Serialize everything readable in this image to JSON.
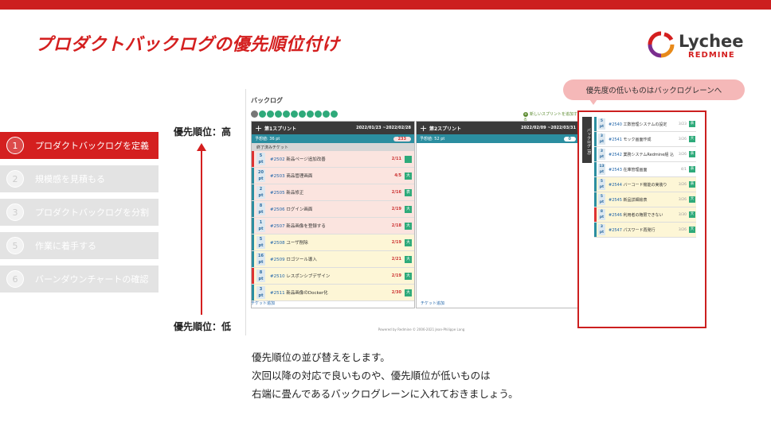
{
  "slide": {
    "title": "プロダクトバックログの優先順位付け",
    "logo_word": "Lychee",
    "logo_sub": "REDMINE"
  },
  "steps": [
    {
      "num": "1",
      "label": "プロダクトバックログを定義",
      "active": true
    },
    {
      "num": "2",
      "label": "規模感を見積もる",
      "active": false
    },
    {
      "num": "3",
      "label": "プロダクトバックログを分割",
      "active": false
    },
    {
      "num": "5",
      "label": "作業に着手する",
      "active": false
    },
    {
      "num": "6",
      "label": "バーンダウンチャートの確認",
      "active": false
    }
  ],
  "priority": {
    "high": "優先順位：高",
    "low": "優先順位：低"
  },
  "screen": {
    "title": "バックログ",
    "new_sprint": "新しいスプリントを追加する",
    "footer": "Powered by Redmine © 2006-2021 Jean-Philippe Lang",
    "sprint1": {
      "name": "第1スプリント",
      "dates": "2022/01/23 ~2022/02/28",
      "estimate": "予想値: 36 pt",
      "pill": "233",
      "done": "終了済みチケット",
      "add": "チケット追加",
      "tickets": [
        {
          "pts": "5 pt",
          "id": "#2502",
          "title": "新品ページ追加改善",
          "due": "2/11",
          "tag": "",
          "color": "pink",
          "edge": "#d33"
        },
        {
          "pts": "20 pt",
          "id": "#2503",
          "title": "商品管理画面",
          "due": "4/5",
          "tag": "大",
          "color": "pink",
          "edge": "#2b8ea0"
        },
        {
          "pts": "2 pt",
          "id": "#2505",
          "title": "新品修正",
          "due": "2/16",
          "tag": "表",
          "color": "pink",
          "edge": "#2b8ea0"
        },
        {
          "pts": "8 pt",
          "id": "#2506",
          "title": "ログイン画面",
          "due": "2/19",
          "tag": "大",
          "color": "pink",
          "edge": "#2b8ea0"
        },
        {
          "pts": "1 pt",
          "id": "#2507",
          "title": "新品画像を登録する",
          "due": "2/18",
          "tag": "大",
          "color": "pink",
          "edge": "#2b8ea0"
        },
        {
          "pts": "5 pt",
          "id": "#2508",
          "title": "ユーザ削除",
          "due": "2/19",
          "tag": "大",
          "color": "yellow",
          "edge": "#2b8ea0"
        },
        {
          "pts": "16 pt",
          "id": "#2509",
          "title": "ロゴツール導入",
          "due": "2/21",
          "tag": "大",
          "color": "yellow",
          "edge": "#2b8ea0"
        },
        {
          "pts": "8 pt",
          "id": "#2510",
          "title": "レスポンシブデザイン",
          "due": "2/19",
          "tag": "大",
          "color": "yellow",
          "edge": "#d33"
        },
        {
          "pts": "3 pt",
          "id": "#2511",
          "title": "新品画像のDocker化",
          "due": "2/30",
          "tag": "大",
          "color": "yellow",
          "edge": "#2b8ea0"
        }
      ]
    },
    "sprint2": {
      "name": "第2スプリント",
      "dates": "2022/02/09 ~2022/03/31",
      "estimate": "予想値: 52 pt",
      "pill": "0",
      "add": "チケット追加"
    }
  },
  "callout": "優先度の低いものはバックログレーンへ",
  "backlog": {
    "label": "バックログ (8)",
    "items": [
      {
        "pts": "5 pt",
        "id": "#2540",
        "title": "工数管理システムの設定",
        "due": "3/23",
        "tag": "表",
        "color": "white",
        "edge": "#2b8ea0"
      },
      {
        "pts": "3 pt",
        "id": "#2541",
        "title": "モック画面作成",
        "due": "3/26",
        "tag": "大",
        "color": "white",
        "edge": "#2b8ea0"
      },
      {
        "pts": "3 pt",
        "id": "#2542",
        "title": "業務システムRedmine組 込",
        "due": "3/26",
        "tag": "表",
        "color": "white",
        "edge": "#2b8ea0"
      },
      {
        "pts": "13 pt",
        "id": "#2543",
        "title": "在庫管理画面",
        "due": "4/1",
        "tag": "表",
        "color": "white",
        "edge": "#2b8ea0"
      },
      {
        "pts": "5 pt",
        "id": "#2544",
        "title": "バーコード機能の実装り",
        "due": "3/26",
        "tag": "表",
        "color": "yellow",
        "edge": "#2b8ea0"
      },
      {
        "pts": "5 pt",
        "id": "#2545",
        "title": "新品詳細絵表",
        "due": "3/26",
        "tag": "大",
        "color": "yellow",
        "edge": "#2b8ea0"
      },
      {
        "pts": "8 pt",
        "id": "#2546",
        "title": "利用者の権限できない",
        "due": "3/30",
        "tag": "大",
        "color": "yellow",
        "edge": "#d33"
      },
      {
        "pts": "3 pt",
        "id": "#2547",
        "title": "パスワード再発行",
        "due": "3/26",
        "tag": "大",
        "color": "yellow",
        "edge": "#2b8ea0"
      }
    ]
  },
  "caption": [
    "優先順位の並び替えをします。",
    "次回以降の対応で良いものや、優先順位が低いものは",
    "右端に畳んであるバックログレーンに入れておきましょう。"
  ]
}
